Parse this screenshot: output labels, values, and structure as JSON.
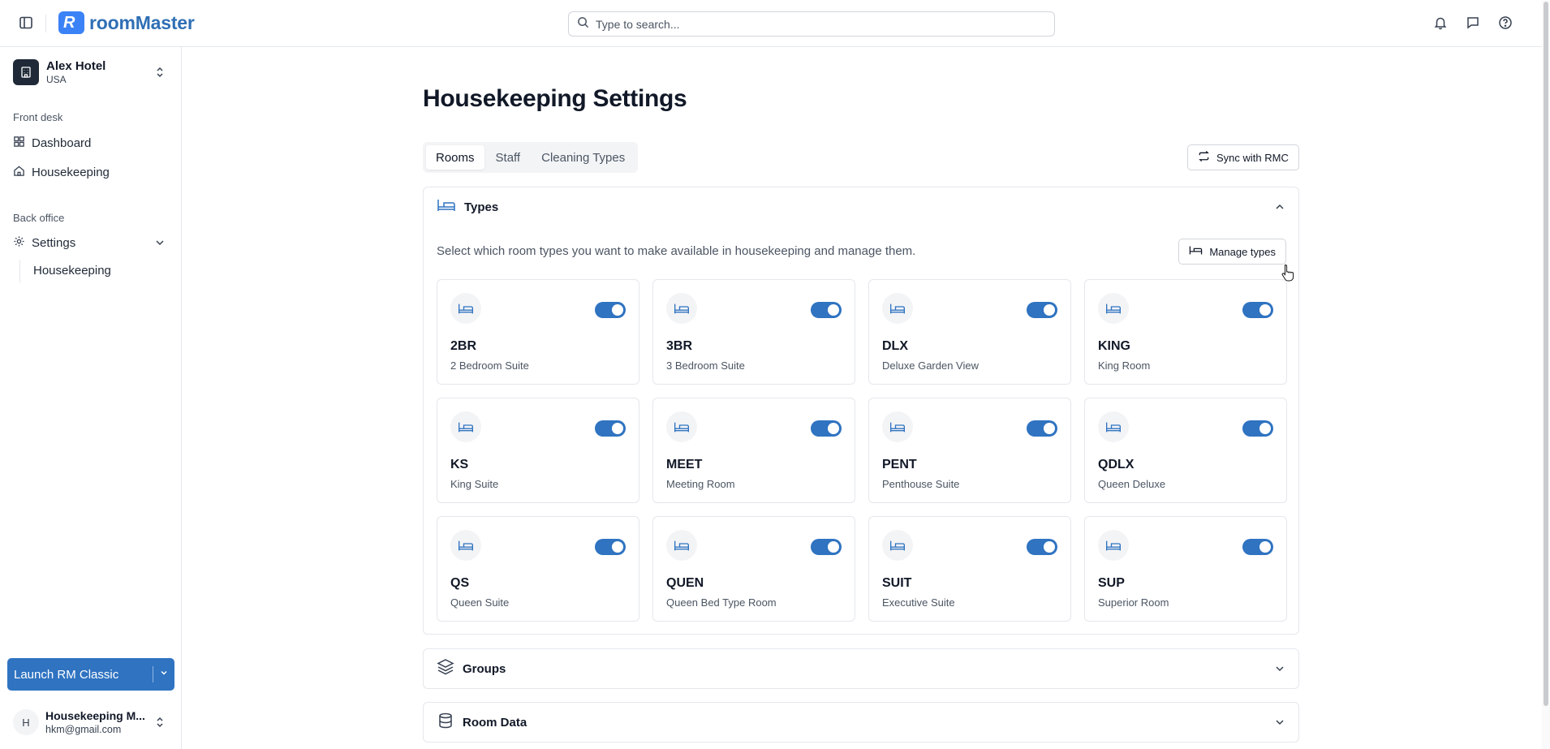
{
  "app": {
    "brand": "roomMaster",
    "search_placeholder": "Type to search..."
  },
  "topbar_icons": [
    "bell-icon",
    "message-icon",
    "help-icon"
  ],
  "sidebar": {
    "hotel": {
      "name": "Alex Hotel",
      "country": "USA"
    },
    "sections": [
      {
        "label": "Front desk"
      },
      {
        "label": "Back office"
      }
    ],
    "front_desk": [
      {
        "label": "Dashboard",
        "icon": "grid-icon"
      },
      {
        "label": "Housekeeping",
        "icon": "home-icon"
      }
    ],
    "back_office": [
      {
        "label": "Settings",
        "icon": "gear-icon"
      }
    ],
    "settings_sub": [
      {
        "label": "Housekeeping"
      }
    ],
    "launch_label": "Launch RM Classic",
    "user": {
      "initial": "H",
      "name": "Housekeeping M...",
      "email": "hkm@gmail.com"
    }
  },
  "main": {
    "title": "Housekeeping Settings",
    "tabs": [
      {
        "label": "Rooms",
        "active": true
      },
      {
        "label": "Staff",
        "active": false
      },
      {
        "label": "Cleaning Types",
        "active": false
      }
    ],
    "sync_label": "Sync with RMC",
    "types": {
      "title": "Types",
      "description": "Select which room types you want to make available in housekeeping and manage them.",
      "manage_label": "Manage types",
      "rooms": [
        {
          "code": "2BR",
          "name": "2 Bedroom Suite",
          "enabled": true
        },
        {
          "code": "3BR",
          "name": "3 Bedroom Suite",
          "enabled": true
        },
        {
          "code": "DLX",
          "name": "Deluxe Garden View",
          "enabled": true
        },
        {
          "code": "KING",
          "name": "King Room",
          "enabled": true
        },
        {
          "code": "KS",
          "name": "King Suite",
          "enabled": true
        },
        {
          "code": "MEET",
          "name": "Meeting Room",
          "enabled": true
        },
        {
          "code": "PENT",
          "name": "Penthouse Suite",
          "enabled": true
        },
        {
          "code": "QDLX",
          "name": "Queen Deluxe",
          "enabled": true
        },
        {
          "code": "QS",
          "name": "Queen Suite",
          "enabled": true
        },
        {
          "code": "QUEN",
          "name": "Queen Bed Type Room",
          "enabled": true
        },
        {
          "code": "SUIT",
          "name": "Executive Suite",
          "enabled": true
        },
        {
          "code": "SUP",
          "name": "Superior Room",
          "enabled": true
        }
      ]
    },
    "groups": {
      "title": "Groups"
    },
    "room_data": {
      "title": "Room Data"
    }
  },
  "colors": {
    "accent": "#2f73c1",
    "brand": "#3b82f6"
  }
}
